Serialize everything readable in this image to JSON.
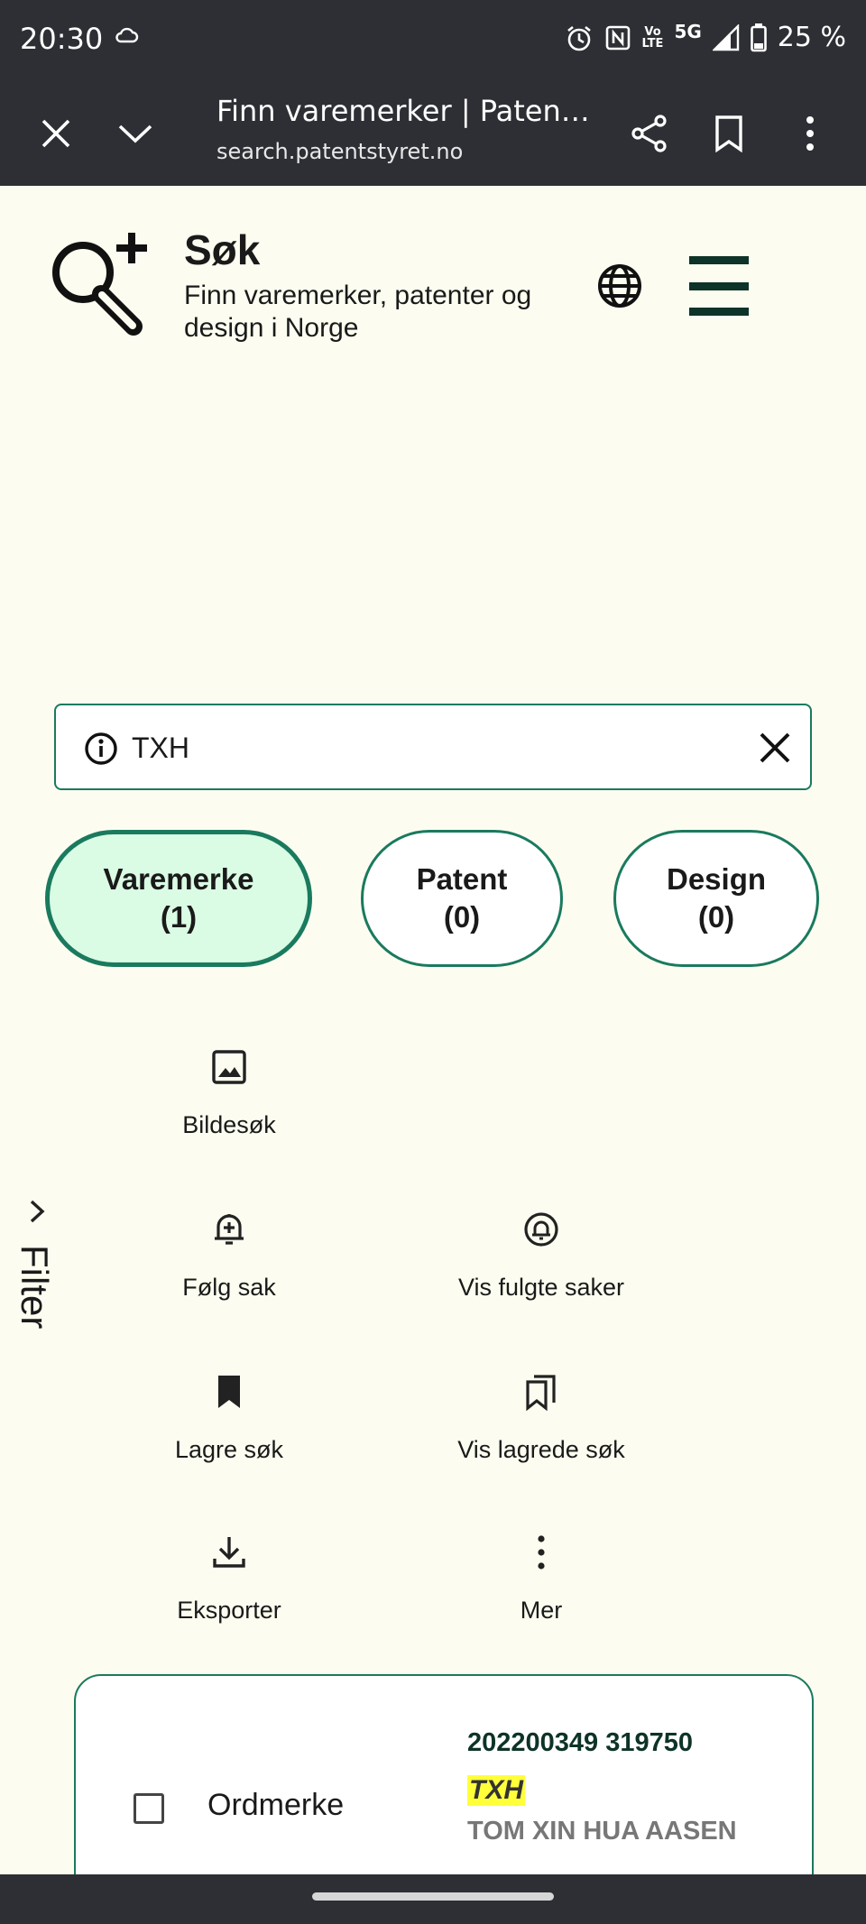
{
  "status_bar": {
    "time": "20:30",
    "network": "5G",
    "volte_line1": "Vo",
    "volte_line2": "LTE",
    "battery": "25 %",
    "icons": [
      "cloud-icon",
      "alarm-icon",
      "nfc-icon",
      "volte-icon",
      "signal-icon",
      "battery-icon"
    ]
  },
  "browser": {
    "title": "Finn varemerker | Paten…",
    "url": "search.patentstyret.no",
    "icons": [
      "close-icon",
      "chevron-down-icon",
      "share-icon",
      "bookmark-icon",
      "more-vert-icon"
    ]
  },
  "header": {
    "title": "Søk",
    "subtitle": "Finn varemerker, patenter og design i Norge",
    "icons": [
      "search-plus-logo-icon",
      "globe-icon",
      "hamburger-menu-icon"
    ]
  },
  "search": {
    "value": "TXH"
  },
  "tabs": [
    {
      "label": "Varemerke",
      "count": "(1)",
      "active": true
    },
    {
      "label": "Patent",
      "count": "(0)",
      "active": false
    },
    {
      "label": "Design",
      "count": "(0)",
      "active": false
    }
  ],
  "actions": {
    "image_search": "Bildesøk",
    "follow_case": "Følg sak",
    "show_followed": "Vis fulgte saker",
    "save_search": "Lagre søk",
    "show_saved": "Vis lagrede søk",
    "export": "Eksporter",
    "more": "Mer"
  },
  "filter": {
    "label": "Filter"
  },
  "result": {
    "type": "Ordmerke",
    "number": "202200349  319750",
    "mark": "TXH",
    "owner": "TOM XIN HUA AASEN"
  },
  "colors": {
    "accent": "#1a7a5e",
    "active_tab_bg": "#dafbe4",
    "page_bg": "#fcfdf0",
    "highlight": "#ffff3a",
    "chrome_bg": "#2e2f34"
  }
}
